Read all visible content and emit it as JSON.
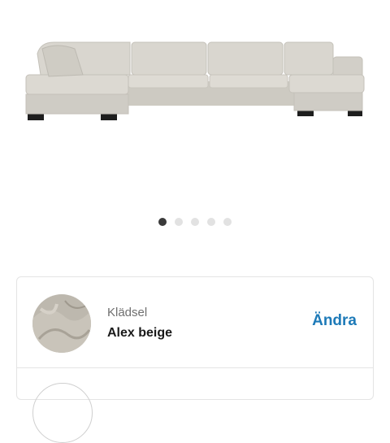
{
  "carousel": {
    "slide_count": 5,
    "active_index": 0
  },
  "options": [
    {
      "label": "Klädsel",
      "value": "Alex beige",
      "action_label": "Ändra"
    }
  ],
  "colors": {
    "accent": "#1d7ab8",
    "fabric": "#d6d3cc",
    "dot_active": "#3a3a3a",
    "dot_inactive": "#e2e2e2"
  }
}
